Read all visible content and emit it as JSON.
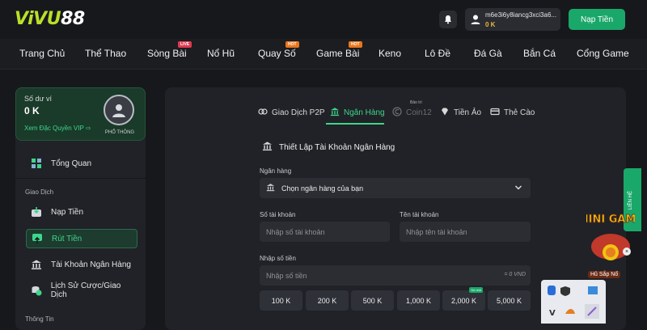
{
  "brand": {
    "logo_a": "ViVU",
    "logo_b": "88"
  },
  "header": {
    "username": "m6e3i6y8iancg3xci3a6...",
    "balance": "0 K",
    "deposit_label": "Nạp Tiền"
  },
  "nav": {
    "items": [
      {
        "label": "Trang Chủ"
      },
      {
        "label": "Thể Thao"
      },
      {
        "label": "Sòng Bài",
        "tag": "LIVE"
      },
      {
        "label": "Nổ Hũ"
      },
      {
        "label": "Quay Số",
        "tag": "HOT"
      },
      {
        "label": "Game Bài",
        "tag": "HOT"
      },
      {
        "label": "Keno"
      },
      {
        "label": "Lô Đề"
      },
      {
        "label": "Đá Gà"
      },
      {
        "label": "Bắn Cá"
      },
      {
        "label": "Cổng Game"
      }
    ]
  },
  "wallet": {
    "label": "Số dư ví",
    "amount": "0 K",
    "vip_link": "Xem Đặc Quyền VIP",
    "rank": "PHỔ THÔNG"
  },
  "sidebar": {
    "overview": "Tổng Quan",
    "section_transactions": "Giao Dịch",
    "items": [
      {
        "label": "Nạp Tiền"
      },
      {
        "label": "Rút Tiền",
        "active": true
      },
      {
        "label": "Tài Khoản Ngân Hàng"
      },
      {
        "label": "Lịch Sử Cược/Giao Dịch"
      }
    ],
    "section_info": "Thông Tin"
  },
  "tabs": [
    {
      "label": "Giao Dịch P2P"
    },
    {
      "label": "Ngân Hàng",
      "active": true
    },
    {
      "label": "Coin12",
      "badge": "Bảo trì",
      "disabled": true
    },
    {
      "label": "Tiền Ảo"
    },
    {
      "label": "Thẻ Cào"
    }
  ],
  "form": {
    "title": "Thiết Lập Tài Khoản Ngân Hàng",
    "bank_label": "Ngân hàng",
    "bank_value": "Chọn ngân hàng của bạn",
    "account_no_label": "Số tài khoản",
    "account_no_placeholder": "Nhập số tài khoản",
    "account_name_label": "Tên tài khoản",
    "account_name_placeholder": "Nhập tên tài khoản",
    "amount_label": "Nhập số tiền",
    "amount_placeholder": "Nhập số tiền",
    "amount_unit": "= 0 VND"
  },
  "amounts": [
    {
      "label": "100 K"
    },
    {
      "label": "200 K"
    },
    {
      "label": "500 K"
    },
    {
      "label": "1,000 K"
    },
    {
      "label": "2,000 K",
      "tag": "Số nhỏ"
    },
    {
      "label": "5,000 K"
    }
  ],
  "side_tab": {
    "label": "LIÊN HỆ"
  },
  "promo": {
    "text": "Hũ Sắp Nổ",
    "game": "MINI GAME"
  },
  "colors": {
    "accent": "#1aa86a",
    "accent_text": "#3dd68a",
    "bg": "#17181b",
    "panel": "#202227"
  }
}
